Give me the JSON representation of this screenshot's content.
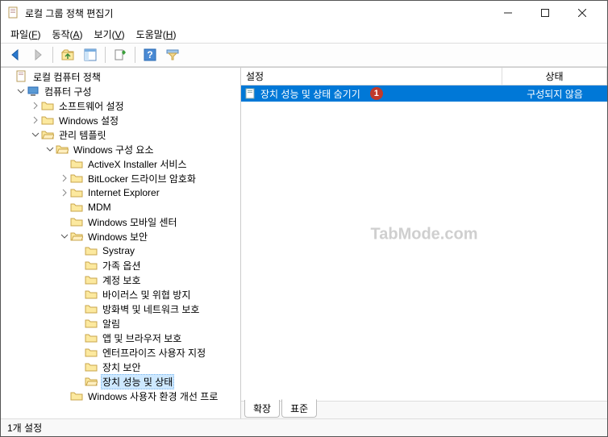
{
  "window": {
    "title": "로컬 그룹 정책 편집기"
  },
  "menu": {
    "file": "파일",
    "file_key": "F",
    "action": "동작",
    "action_key": "A",
    "view": "보기",
    "view_key": "V",
    "help": "도움말",
    "help_key": "H"
  },
  "tree": {
    "root": "로컬 컴퓨터 정책",
    "computer_config": "컴퓨터 구성",
    "software_settings": "소프트웨어 설정",
    "windows_settings": "Windows 설정",
    "admin_templates": "관리 템플릿",
    "windows_components": "Windows 구성 요소",
    "activex": "ActiveX Installer 서비스",
    "bitlocker": "BitLocker 드라이브 암호화",
    "ie": "Internet Explorer",
    "mdm": "MDM",
    "mobility": "Windows 모바일 센터",
    "windows_security": "Windows 보안",
    "systray": "Systray",
    "family": "가족 옵션",
    "account": "계정 보호",
    "virus": "바이러스 및 위협 방지",
    "firewall": "방화벽 및 네트워크 보호",
    "notify": "알림",
    "app_browser": "앱 및 브라우저 보호",
    "enterprise": "엔터프라이즈 사용자 지정",
    "device_sec": "장치 보안",
    "device_perf": "장치 성능 및 상태",
    "experience": "Windows 사용자 환경 개선 프로"
  },
  "list": {
    "header_setting": "설정",
    "header_state": "상태",
    "rows": [
      {
        "name": "장치 성능 및 상태 숨기기",
        "state": "구성되지 않음",
        "badge": "1"
      }
    ]
  },
  "tabs": {
    "extended": "확장",
    "standard": "표준"
  },
  "statusbar": "1개 설정",
  "watermark": "TabMode.com"
}
